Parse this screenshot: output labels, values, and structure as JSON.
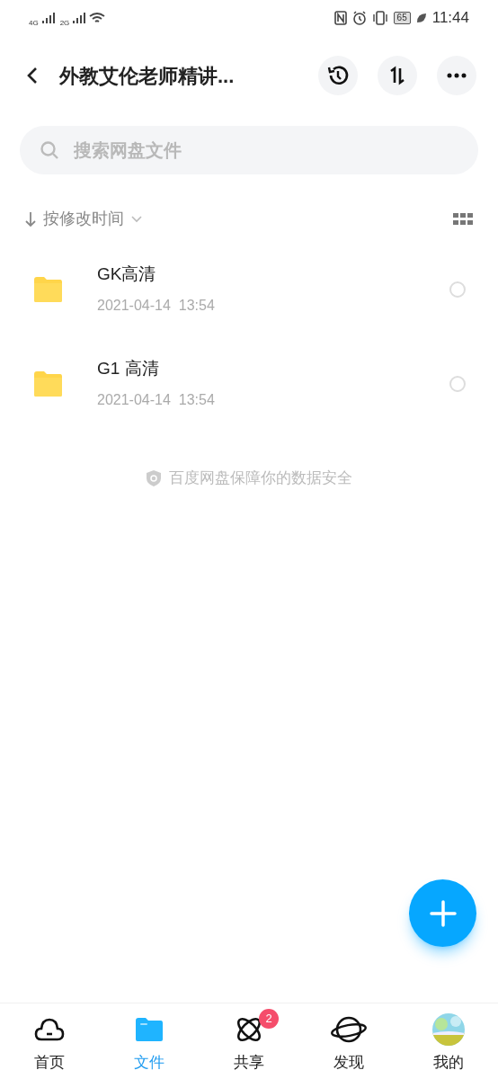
{
  "status_bar": {
    "network_1": "4G",
    "network_2": "2G",
    "battery": "65",
    "time": "11:44"
  },
  "header": {
    "title": "外教艾伦老师精讲..."
  },
  "search": {
    "placeholder": "搜索网盘文件"
  },
  "sort": {
    "label": "按修改时间"
  },
  "files": [
    {
      "name": "GK高清",
      "date": "2021-04-14  13:54",
      "selected": false
    },
    {
      "name": "G1 高清",
      "date": "2021-04-14  13:54",
      "selected": false
    }
  ],
  "notice": "百度网盘保障你的数据安全",
  "tabs": [
    {
      "kind": "cloud",
      "label": "首页",
      "selected": false
    },
    {
      "kind": "folder",
      "label": "文件",
      "selected": true
    },
    {
      "kind": "atom",
      "label": "共享",
      "selected": false,
      "badge": "2"
    },
    {
      "kind": "planet",
      "label": "发现",
      "selected": false
    },
    {
      "kind": "avatar",
      "label": "我的",
      "selected": false
    }
  ]
}
